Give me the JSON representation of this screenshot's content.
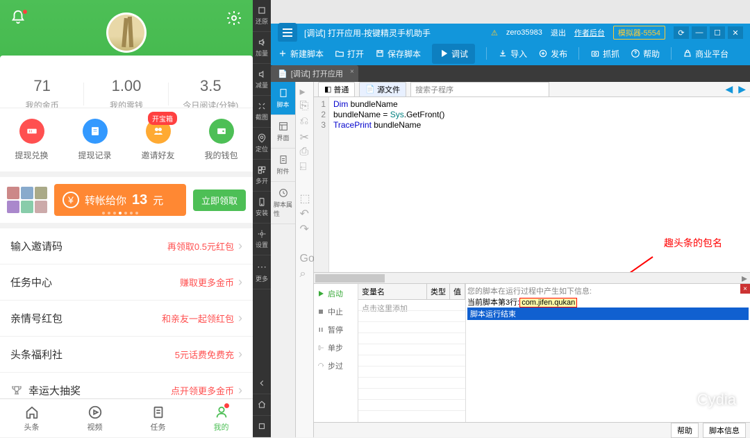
{
  "phone": {
    "stats": [
      {
        "value": "71",
        "label": "我的金币"
      },
      {
        "value": "1.00",
        "label": "我的零钱"
      },
      {
        "value": "3.5",
        "label": "今日阅读(分钟)"
      }
    ],
    "actions": [
      {
        "label": "提现兑换"
      },
      {
        "label": "提现记录"
      },
      {
        "label": "邀请好友",
        "badge": "开宝箱"
      },
      {
        "label": "我的钱包"
      }
    ],
    "promo": {
      "text_prefix": "转帐给你",
      "amount": "13",
      "suffix": "元",
      "claim": "立即领取"
    },
    "list": [
      {
        "title": "输入邀请码",
        "action": "再领取0.5元红包"
      },
      {
        "title": "任务中心",
        "action": "赚取更多金币"
      },
      {
        "title": "亲情号红包",
        "action": "和亲友一起领红包"
      },
      {
        "title": "头条福利社",
        "action": "5元话费免费充"
      },
      {
        "title": "幸运大抽奖",
        "action": "点开领更多金币",
        "icon": true
      }
    ],
    "tabs": [
      {
        "label": "头条"
      },
      {
        "label": "视频"
      },
      {
        "label": "任务"
      },
      {
        "label": "我的",
        "active": true,
        "dot": true
      }
    ]
  },
  "vtoolbar": {
    "items": [
      "还原",
      "加量",
      "减量",
      "截图",
      "定位",
      "多开",
      "安装",
      "设置",
      "更多"
    ]
  },
  "ide": {
    "title": "[调试] 打开应用-按键精灵手机助手",
    "user": "zero35983",
    "logout": "退出",
    "author": "作者后台",
    "emulator": "模拟器-5554",
    "toolbar": [
      {
        "label": "新建脚本",
        "icon": "plus"
      },
      {
        "label": "打开",
        "icon": "folder"
      },
      {
        "label": "保存脚本",
        "icon": "save"
      },
      {
        "label": "调试",
        "icon": "play",
        "active": true
      },
      {
        "label": "导入",
        "icon": "import"
      },
      {
        "label": "发布",
        "icon": "publish"
      },
      {
        "label": "抓抓",
        "icon": "camera"
      },
      {
        "label": "帮助",
        "icon": "help"
      },
      {
        "label": "商业平台",
        "icon": "biz"
      }
    ],
    "tab": {
      "label": "[调试] 打开应用"
    },
    "leftbar": [
      "脚本",
      "界面",
      "附件",
      "脚本属性"
    ],
    "editor_tabs": {
      "normal": "普通",
      "source": "源文件",
      "search": "搜索子程序"
    },
    "code": [
      {
        "n": "1",
        "html": "<span class='kw'>Dim</span> bundleName"
      },
      {
        "n": "2",
        "html": "bundleName = <span class='fn'>Sys</span>.GetFront()"
      },
      {
        "n": "3",
        "html": "<span class='kw'>TracePrint</span> bundleName"
      }
    ],
    "annotation": "趣头条的包名",
    "debug_btns": [
      "启动",
      "中止",
      "暂停",
      "单步",
      "步过"
    ],
    "vars_header": [
      "变量名",
      "类型",
      "值"
    ],
    "vars_placeholder": "点击这里添加",
    "output": {
      "l1": "您的脚本在运行过程中产生如下信息:",
      "l2_prefix": "当前脚本第3行:",
      "l2_value": "com.jifen.qukan",
      "l3": "脚本运行结束"
    },
    "bottom_tabs": [
      "帮助",
      "脚本信息"
    ]
  },
  "watermark": "Cydia"
}
